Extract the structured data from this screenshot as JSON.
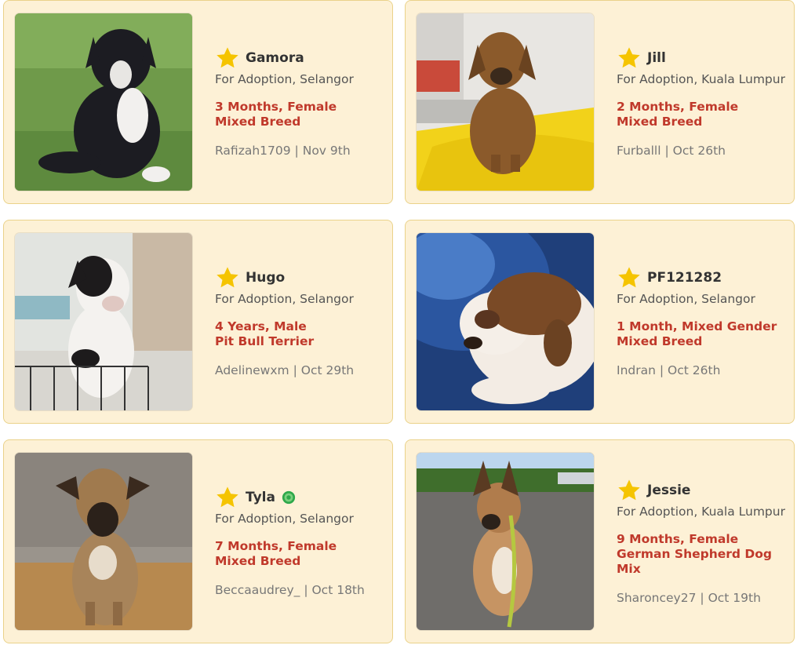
{
  "listings": [
    {
      "name": "Gamora",
      "status": "For Adoption, Selangor",
      "age": "3 Months, Female",
      "breed": "Mixed Breed",
      "user": "Rafizah1709",
      "separator": "|",
      "date": "Nov 9th",
      "photo_icon": "puppy-photo"
    },
    {
      "name": "Jill",
      "status": "For Adoption, Kuala Lumpur",
      "age": "2 Months, Female",
      "breed": "Mixed Breed",
      "user": "Furballl",
      "separator": "|",
      "date": "Oct 26th",
      "photo_icon": "puppy-photo"
    },
    {
      "name": "Hugo",
      "status": "For Adoption, Selangor",
      "age": "4 Years, Male",
      "breed": "Pit Bull Terrier",
      "user": "Adelinewxm",
      "separator": "|",
      "date": "Oct 29th",
      "photo_icon": "dog-photo"
    },
    {
      "name": "PF121282",
      "status": "For Adoption, Selangor",
      "age": "1 Month, Mixed Gender",
      "breed": "Mixed Breed",
      "user": "Indran",
      "separator": "|",
      "date": "Oct 26th",
      "photo_icon": "puppy-photo"
    },
    {
      "name": "Tyla",
      "status": "For Adoption, Selangor",
      "age": "7 Months, Female",
      "breed": "Mixed Breed",
      "user": "Beccaaudrey_",
      "separator": "|",
      "date": "Oct 18th",
      "photo_icon": "dog-photo",
      "verified": true
    },
    {
      "name": "Jessie",
      "status": "For Adoption, Kuala Lumpur",
      "age": "9 Months, Female",
      "breed": "German Shepherd Dog Mix",
      "user": "Sharoncey27",
      "separator": "|",
      "date": "Oct 19th",
      "photo_icon": "dog-photo"
    }
  ],
  "icons": {
    "favorite": "star-icon",
    "verified": "verified-badge-icon"
  },
  "colors": {
    "card_bg": "#fdf1d6",
    "card_border": "#ead28a",
    "star": "#f5c400",
    "age_breed": "#c0392b",
    "status": "#555555",
    "meta": "#777777",
    "verified": "#2ea84a"
  }
}
